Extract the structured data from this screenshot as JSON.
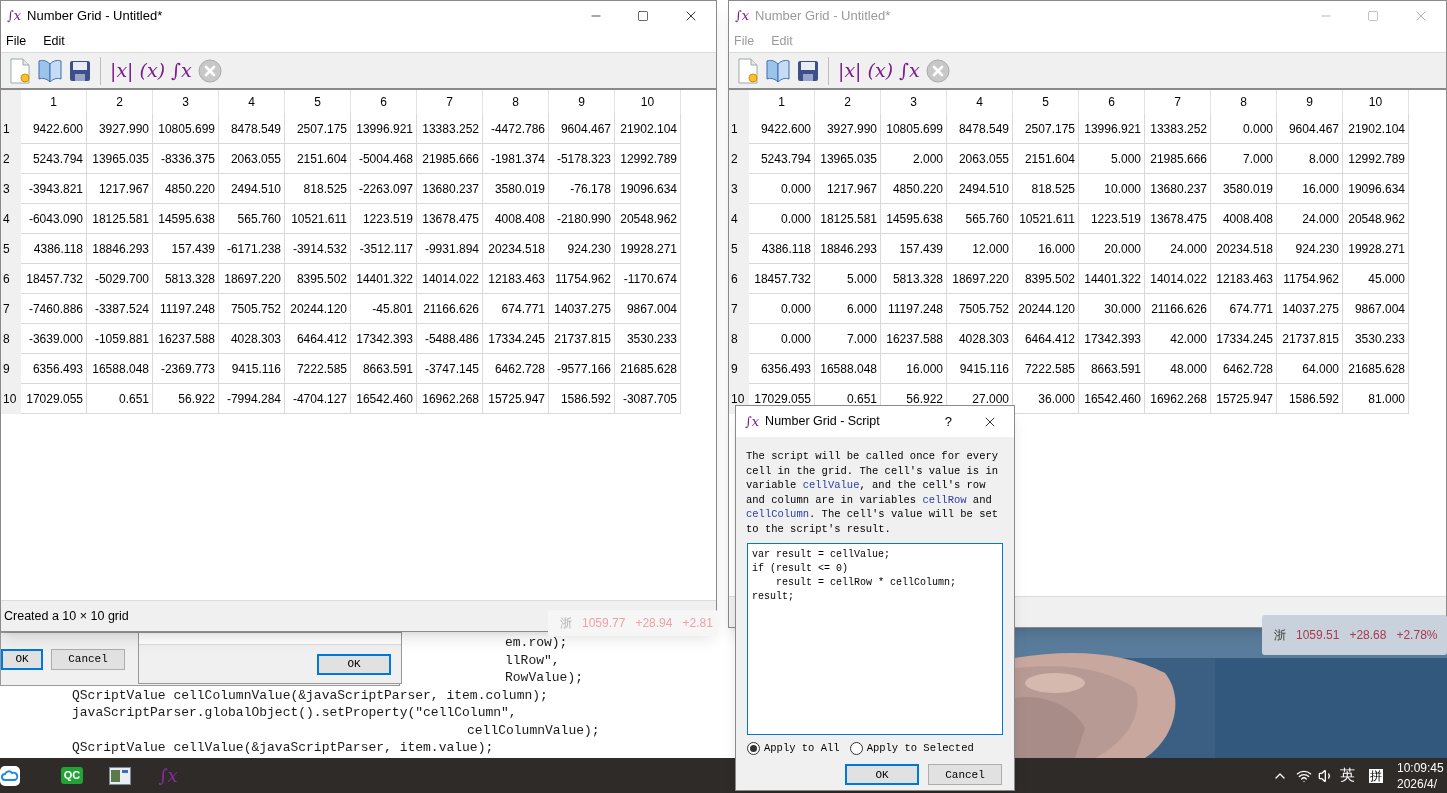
{
  "windows": [
    {
      "app_icon": "∫x",
      "title": "Number Grid - Untitled*",
      "active": true,
      "menu": [
        "File",
        "Edit"
      ],
      "toolbar_formulas": [
        "|x|",
        "(x)",
        "∫x"
      ],
      "status": "Created a 10 × 10 grid",
      "grid": {
        "columns": [
          "1",
          "2",
          "3",
          "4",
          "5",
          "6",
          "7",
          "8",
          "9",
          "10"
        ],
        "rows": [
          {
            "header": "1",
            "cells": [
              "9422.600",
              "3927.990",
              "10805.699",
              "8478.549",
              "2507.175",
              "13996.921",
              "13383.252",
              "-4472.786",
              "9604.467",
              "21902.104"
            ]
          },
          {
            "header": "2",
            "cells": [
              "5243.794",
              "13965.035",
              "-8336.375",
              "2063.055",
              "2151.604",
              "-5004.468",
              "21985.666",
              "-1981.374",
              "-5178.323",
              "12992.789"
            ]
          },
          {
            "header": "3",
            "cells": [
              "-3943.821",
              "1217.967",
              "4850.220",
              "2494.510",
              "818.525",
              "-2263.097",
              "13680.237",
              "3580.019",
              "-76.178",
              "19096.634"
            ]
          },
          {
            "header": "4",
            "cells": [
              "-6043.090",
              "18125.581",
              "14595.638",
              "565.760",
              "10521.611",
              "1223.519",
              "13678.475",
              "4008.408",
              "-2180.990",
              "20548.962"
            ]
          },
          {
            "header": "5",
            "cells": [
              "4386.118",
              "18846.293",
              "157.439",
              "-6171.238",
              "-3914.532",
              "-3512.117",
              "-9931.894",
              "20234.518",
              "924.230",
              "19928.271"
            ]
          },
          {
            "header": "6",
            "cells": [
              "18457.732",
              "-5029.700",
              "5813.328",
              "18697.220",
              "8395.502",
              "14401.322",
              "14014.022",
              "12183.463",
              "11754.962",
              "-1170.674"
            ]
          },
          {
            "header": "7",
            "cells": [
              "-7460.886",
              "-3387.524",
              "11197.248",
              "7505.752",
              "20244.120",
              "-45.801",
              "21166.626",
              "674.771",
              "14037.275",
              "9867.004"
            ]
          },
          {
            "header": "8",
            "cells": [
              "-3639.000",
              "-1059.881",
              "16237.588",
              "4028.303",
              "6464.412",
              "17342.393",
              "-5488.486",
              "17334.245",
              "21737.815",
              "3530.233"
            ]
          },
          {
            "header": "9",
            "cells": [
              "6356.493",
              "16588.048",
              "-2369.773",
              "9415.116",
              "7222.585",
              "8663.591",
              "-3747.145",
              "6462.728",
              "-9577.166",
              "21685.628"
            ]
          },
          {
            "header": "10",
            "cells": [
              "17029.055",
              "0.651",
              "56.922",
              "-7994.284",
              "-4704.127",
              "16542.460",
              "16962.268",
              "15725.947",
              "1586.592",
              "-3087.705"
            ]
          }
        ]
      }
    },
    {
      "app_icon": "∫x",
      "title": "Number Grid - Untitled*",
      "active": false,
      "menu": [
        "File",
        "Edit"
      ],
      "toolbar_formulas": [
        "|x|",
        "(x)",
        "∫x"
      ],
      "grid": {
        "columns": [
          "1",
          "2",
          "3",
          "4",
          "5",
          "6",
          "7",
          "8",
          "9",
          "10"
        ],
        "rows": [
          {
            "header": "1",
            "cells": [
              "9422.600",
              "3927.990",
              "10805.699",
              "8478.549",
              "2507.175",
              "13996.921",
              "13383.252",
              "0.000",
              "9604.467",
              "21902.104"
            ]
          },
          {
            "header": "2",
            "cells": [
              "5243.794",
              "13965.035",
              "2.000",
              "2063.055",
              "2151.604",
              "5.000",
              "21985.666",
              "7.000",
              "8.000",
              "12992.789"
            ]
          },
          {
            "header": "3",
            "cells": [
              "0.000",
              "1217.967",
              "4850.220",
              "2494.510",
              "818.525",
              "10.000",
              "13680.237",
              "3580.019",
              "16.000",
              "19096.634"
            ]
          },
          {
            "header": "4",
            "cells": [
              "0.000",
              "18125.581",
              "14595.638",
              "565.760",
              "10521.611",
              "1223.519",
              "13678.475",
              "4008.408",
              "24.000",
              "20548.962"
            ]
          },
          {
            "header": "5",
            "cells": [
              "4386.118",
              "18846.293",
              "157.439",
              "12.000",
              "16.000",
              "20.000",
              "24.000",
              "20234.518",
              "924.230",
              "19928.271"
            ]
          },
          {
            "header": "6",
            "cells": [
              "18457.732",
              "5.000",
              "5813.328",
              "18697.220",
              "8395.502",
              "14401.322",
              "14014.022",
              "12183.463",
              "11754.962",
              "45.000"
            ]
          },
          {
            "header": "7",
            "cells": [
              "0.000",
              "6.000",
              "11197.248",
              "7505.752",
              "20244.120",
              "30.000",
              "21166.626",
              "674.771",
              "14037.275",
              "9867.004"
            ]
          },
          {
            "header": "8",
            "cells": [
              "0.000",
              "7.000",
              "16237.588",
              "4028.303",
              "6464.412",
              "17342.393",
              "42.000",
              "17334.245",
              "21737.815",
              "3530.233"
            ]
          },
          {
            "header": "9",
            "cells": [
              "6356.493",
              "16588.048",
              "16.000",
              "9415.116",
              "7222.585",
              "8663.591",
              "48.000",
              "6462.728",
              "64.000",
              "21685.628"
            ]
          },
          {
            "header": "10",
            "cells": [
              "17029.055",
              "0.651",
              "56.922",
              "27.000",
              "36.000",
              "16542.460",
              "16962.268",
              "15725.947",
              "1586.592",
              "81.000"
            ]
          }
        ]
      }
    }
  ],
  "code_lines": [
    {
      "kind": "partial",
      "text": "em.row);"
    },
    {
      "kind": "partial",
      "text": "llRow\","
    },
    {
      "kind": "partial",
      "text": "RowValue);"
    },
    {
      "kind": "plain",
      "text": "QScriptValue cellColumnValue(&javaScriptParser, item.column);"
    },
    {
      "kind": "plain",
      "text": "javaScriptParser.globalObject().setProperty(\"cellColumn\","
    },
    {
      "kind": "continuation",
      "text": "cellColumnValue);"
    },
    {
      "kind": "plain",
      "text": "QScriptValue cellValue(&javaScriptParser, item.value);"
    }
  ],
  "background_dialogs": [
    {
      "buttons": [
        "OK",
        "Cancel"
      ]
    },
    {
      "buttons": [
        "OK"
      ]
    }
  ],
  "stock_widgets": [
    {
      "faded": true,
      "region": "浙",
      "price": "1059.77",
      "change": "+28.94",
      "percent": "+2.81"
    },
    {
      "faded": false,
      "region": "浙",
      "price": "1059.51",
      "change": "+28.68",
      "percent": "+2.78%"
    }
  ],
  "script_dialog": {
    "app_icon": "∫x",
    "title": "Number Grid - Script",
    "help": "?",
    "description": [
      {
        "kind": "plain",
        "text": "The script will be called once for every cell in the grid. The cell's value is in variable "
      },
      {
        "kind": "variable",
        "text": "cellValue"
      },
      {
        "kind": "plain",
        "text": ", and the cell's row and column are in variables "
      },
      {
        "kind": "variable",
        "text": "cellRow"
      },
      {
        "kind": "plain",
        "text": " and "
      },
      {
        "kind": "variable",
        "text": "cellColumn"
      },
      {
        "kind": "plain",
        "text": ". The cell's value will be set to the script's result."
      }
    ],
    "script": "var result = cellValue;\nif (result <= 0)\n    result = cellRow * cellColumn;\nresult;",
    "options": [
      {
        "label": "Apply to All",
        "selected": true
      },
      {
        "label": "Apply to Selected",
        "selected": false
      }
    ],
    "buttons": [
      "OK",
      "Cancel"
    ]
  },
  "taskbar": {
    "apps": [
      {
        "kind": "cloud"
      },
      {
        "kind": "badge",
        "label": "QC"
      },
      {
        "kind": "window"
      },
      {
        "kind": "formula",
        "label": "∫x"
      }
    ],
    "input_mode": "英",
    "ime": "拼",
    "time": "10:09:45",
    "date": "2026/4/"
  }
}
